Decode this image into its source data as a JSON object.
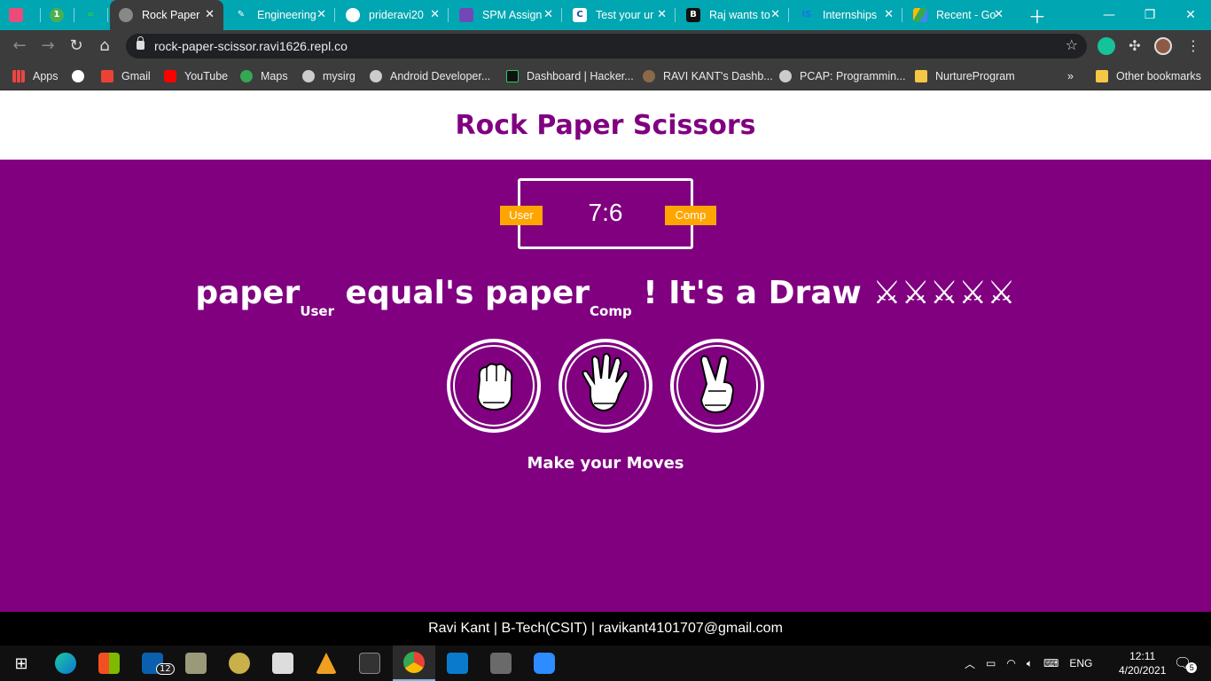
{
  "browser": {
    "tabs": [
      {
        "label": "",
        "favicon": "gitmoji-icon"
      },
      {
        "label": "",
        "favicon": "whatsapp-icon"
      },
      {
        "label": "",
        "favicon": "link-icon"
      },
      {
        "label": "Rock Paper",
        "favicon": "globe-icon",
        "active": true
      },
      {
        "label": "Engineering",
        "favicon": "pencil-icon"
      },
      {
        "label": "prideravi20",
        "favicon": "github-icon"
      },
      {
        "label": "SPM Assign",
        "favicon": "forms-icon"
      },
      {
        "label": "Test your ur",
        "favicon": "c-icon"
      },
      {
        "label": "Raj wants to",
        "favicon": "b-icon"
      },
      {
        "label": "Internships",
        "favicon": "is-icon"
      },
      {
        "label": "Recent - Go",
        "favicon": "drive-icon"
      }
    ],
    "url": "rock-paper-scissor.ravi1626.repl.co",
    "bookmarks": [
      "Apps",
      "",
      "Gmail",
      "YouTube",
      "Maps",
      "mysirg",
      "Android Developer...",
      "Dashboard | Hacker...",
      "RAVI KANT's Dashb...",
      "PCAP: Programmin...",
      "NurtureProgram"
    ],
    "more_bookmarks": "»",
    "other_bookmarks": "Other bookmarks"
  },
  "page": {
    "title": "Rock Paper Scissors",
    "score": {
      "value": "7:6",
      "user_label": "User",
      "comp_label": "Comp"
    },
    "result": {
      "user_choice": "paper",
      "user_sub": "User",
      "middle": " equal's ",
      "comp_choice": "paper",
      "comp_sub": "Comp",
      "tail": " ! It's a Draw ⚔⚔⚔⚔⚔"
    },
    "choices": [
      "rock",
      "paper",
      "scissors"
    ],
    "prompt": "Make your Moves",
    "footer": "Ravi Kant | B-Tech(CSIT) | ravikant4101707@gmail.com"
  },
  "taskbar": {
    "mail_badge": "12",
    "language": "ENG",
    "time": "12:11",
    "date": "4/20/2021",
    "notification_count": "5"
  },
  "colors": {
    "brand_purple": "#800080",
    "badge_orange": "#ffa500",
    "tabstrip": "#00a6b2"
  }
}
